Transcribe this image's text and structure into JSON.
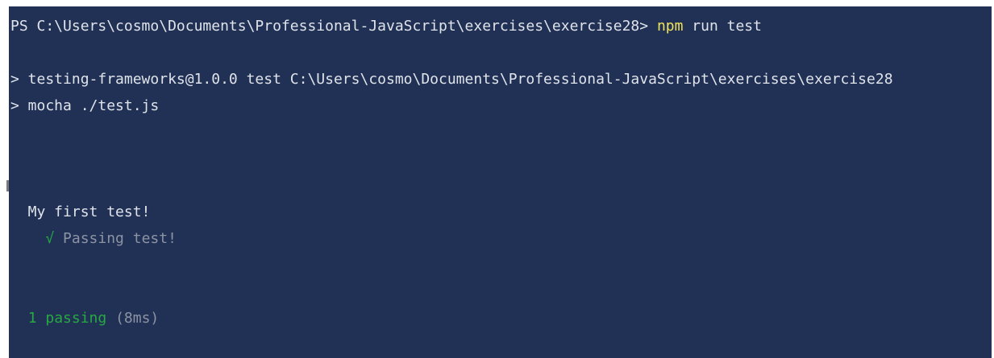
{
  "terminal": {
    "prompt": "PS C:\\Users\\cosmo\\Documents\\Professional-JavaScript\\exercises\\exercise28> ",
    "command_npm": "npm",
    "command_rest": " run test",
    "script_line_1": "> testing-frameworks@1.0.0 test C:\\Users\\cosmo\\Documents\\Professional-JavaScript\\exercises\\exercise28",
    "script_line_2": "> mocha ./test.js",
    "suite_title": "  My first test!",
    "test_indent": "    ",
    "test_check": "√",
    "test_title": " Passing test!",
    "summary_indent": "  ",
    "summary_count": "1 passing",
    "summary_time": " (8ms)"
  },
  "colors": {
    "background": "#213055",
    "text": "#dfe3ea",
    "npm_keyword": "#f0e25a",
    "pass_green": "#27a843",
    "muted_gray": "#8c93a3"
  },
  "icons": {
    "test_check": "check-mark-icon"
  }
}
